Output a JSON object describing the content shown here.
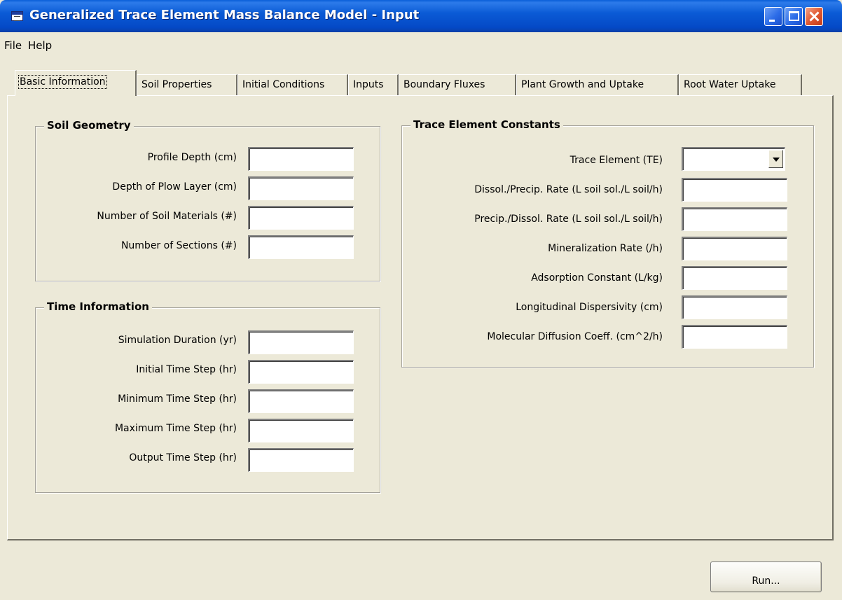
{
  "window": {
    "title": "Generalized Trace Element Mass Balance Model - Input",
    "controls": [
      "minimize-icon",
      "maximize-icon",
      "close-icon"
    ]
  },
  "menu": {
    "items": [
      "File",
      "Help"
    ]
  },
  "tabs": [
    {
      "label": "Basic Information",
      "active": true
    },
    {
      "label": "Soil Properties",
      "active": false
    },
    {
      "label": "Initial Conditions",
      "active": false
    },
    {
      "label": "Inputs",
      "active": false
    },
    {
      "label": "Boundary Fluxes",
      "active": false
    },
    {
      "label": "Plant Growth and Uptake",
      "active": false
    },
    {
      "label": "Root Water Uptake",
      "active": false
    }
  ],
  "soil_geometry": {
    "title": "Soil Geometry",
    "fields": [
      {
        "label": "Profile Depth (cm)",
        "value": ""
      },
      {
        "label": "Depth of Plow Layer (cm)",
        "value": ""
      },
      {
        "label": "Number of Soil Materials (#)",
        "value": ""
      },
      {
        "label": "Number of Sections (#)",
        "value": ""
      }
    ]
  },
  "time_information": {
    "title": "Time Information",
    "fields": [
      {
        "label": "Simulation Duration (yr)",
        "value": ""
      },
      {
        "label": "Initial Time Step (hr)",
        "value": ""
      },
      {
        "label": "Minimum Time Step (hr)",
        "value": ""
      },
      {
        "label": "Maximum Time Step (hr)",
        "value": ""
      },
      {
        "label": "Output Time Step (hr)",
        "value": ""
      }
    ]
  },
  "trace_element_constants": {
    "title": "Trace Element Constants",
    "trace_element": {
      "label": "Trace Element (TE)",
      "value": ""
    },
    "fields": [
      {
        "label": "Dissol./Precip. Rate (L soil sol./L soil/h)",
        "value": ""
      },
      {
        "label": "Precip./Dissol. Rate (L soil sol./L soil/h)",
        "value": ""
      },
      {
        "label": "Mineralization Rate (/h)",
        "value": ""
      },
      {
        "label": "Adsorption Constant (L/kg)",
        "value": ""
      },
      {
        "label": "Longitudinal Dispersivity (cm)",
        "value": ""
      },
      {
        "label": "Molecular Diffusion Coeff. (cm^2/h)",
        "value": ""
      }
    ]
  },
  "actions": {
    "run_label": "Run..."
  },
  "colors": {
    "window_bg": "#ECE9D8",
    "titlebar": "#0B5BD6",
    "close_button": "#E15A34"
  }
}
